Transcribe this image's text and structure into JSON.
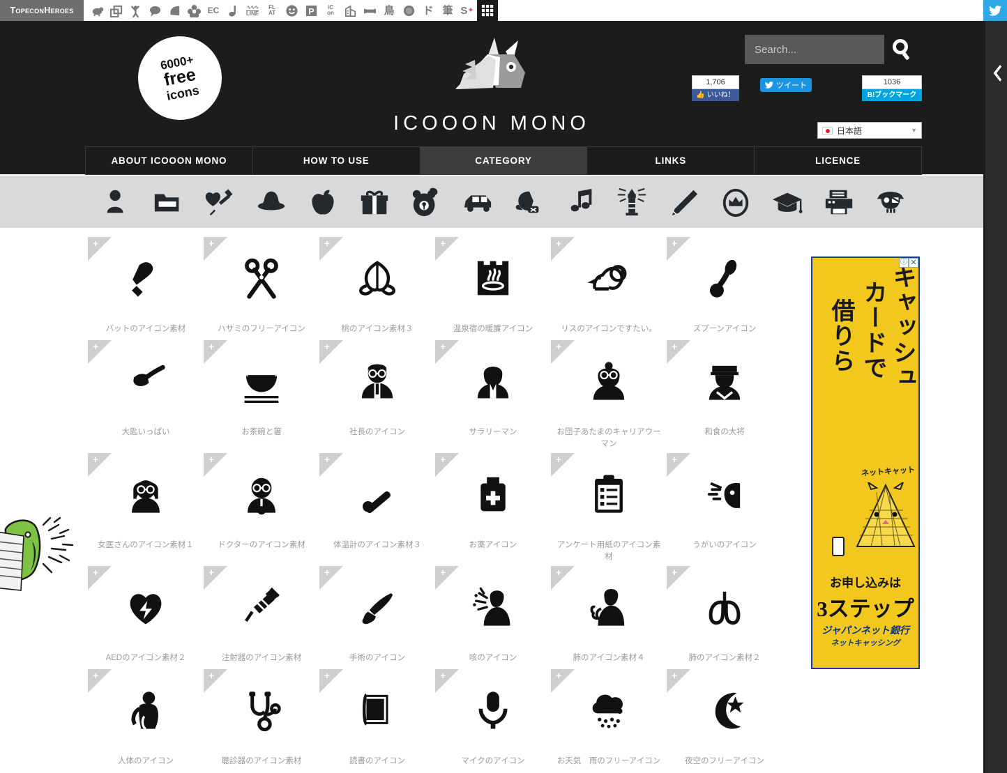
{
  "topbar": {
    "logo_text": "TopeconHeroes",
    "icons": [
      {
        "name": "sheep-icon",
        "glyph": "🐑"
      },
      {
        "name": "copy-icon",
        "glyph": "⧉"
      },
      {
        "name": "person-cheering-icon",
        "glyph": "Ɣ"
      },
      {
        "name": "speech-bubble-icon",
        "glyph": "⬤"
      },
      {
        "name": "leaf-icon",
        "glyph": "◆"
      },
      {
        "name": "flower-icon",
        "glyph": "❁"
      },
      {
        "name": "ec-text-icon",
        "glyph": "EC"
      },
      {
        "name": "music-note-icon",
        "glyph": "♪"
      },
      {
        "name": "line-icon",
        "glyph": "LINE"
      },
      {
        "name": "flat-icon",
        "glyph": "FLAT"
      },
      {
        "name": "smiley-icon",
        "glyph": "☺"
      },
      {
        "name": "parking-icon",
        "glyph": "P"
      },
      {
        "name": "icon-text-icon",
        "glyph": "iCon"
      },
      {
        "name": "building-icon",
        "glyph": "⌂"
      },
      {
        "name": "sofa-icon",
        "glyph": "▬"
      },
      {
        "name": "bird-kanji-icon",
        "glyph": "鳥"
      },
      {
        "name": "badge-round-icon",
        "glyph": "⬮"
      },
      {
        "name": "do-katakana-icon",
        "glyph": "ド"
      },
      {
        "name": "brush-kanji-icon",
        "glyph": "筆"
      },
      {
        "name": "s-plus-icon",
        "glyph": "S"
      },
      {
        "name": "grid-menu-icon",
        "glyph": "☷"
      }
    ],
    "twitter_label": "twitter-icon"
  },
  "rail": {
    "collapse_chevron": "‹"
  },
  "header": {
    "badge": {
      "line1": "6000+",
      "line2": "free",
      "line3": "icons"
    },
    "brand_name": "ICOOON MONO",
    "logo_name": "unicorn-logo",
    "search": {
      "placeholder": "Search...",
      "value": ""
    },
    "social": {
      "facebook_count": "1,706",
      "facebook_label": "いいね！",
      "twitter_label": "ツイート",
      "hatena_count": "1036",
      "hatena_label": "B!ブックマーク"
    },
    "language": {
      "selected": "日本語",
      "caret": "▼"
    }
  },
  "nav": {
    "items": [
      {
        "label": "ABOUT ICOOON MONO",
        "active": false,
        "key": "about"
      },
      {
        "label": "HOW TO USE",
        "active": false,
        "key": "how-to-use"
      },
      {
        "label": "CATEGORY",
        "active": true,
        "key": "category"
      },
      {
        "label": "LINKS",
        "active": false,
        "key": "links"
      },
      {
        "label": "LICENCE",
        "active": false,
        "key": "licence"
      }
    ]
  },
  "categories": [
    {
      "name": "person-icon"
    },
    {
      "name": "folder-icon"
    },
    {
      "name": "heart-syringe-icon"
    },
    {
      "name": "hat-icon"
    },
    {
      "name": "apple-icon"
    },
    {
      "name": "gift-icon"
    },
    {
      "name": "bear-icon"
    },
    {
      "name": "car-icon"
    },
    {
      "name": "boxing-glove-icon"
    },
    {
      "name": "music-note-icon"
    },
    {
      "name": "lighthouse-icon"
    },
    {
      "name": "pencil-icon"
    },
    {
      "name": "crown-badge-icon"
    },
    {
      "name": "graduation-cap-icon"
    },
    {
      "name": "printer-icon"
    },
    {
      "name": "pirate-skull-icon"
    }
  ],
  "grid": {
    "add_symbol": "+",
    "items": [
      {
        "label": "バットのアイコン素材",
        "icon": "baseball-bat-icon"
      },
      {
        "label": "ハサミのフリーアイコン",
        "icon": "scissors-icon"
      },
      {
        "label": "桃のアイコン素材３",
        "icon": "peach-icon"
      },
      {
        "label": "温泉宿の暖簾アイコン",
        "icon": "onsen-noren-icon"
      },
      {
        "label": "リスのアイコンですたい。",
        "icon": "squirrel-icon"
      },
      {
        "label": "スプーンアイコン",
        "icon": "spoon-icon"
      },
      {
        "label": "大匙いっぱい",
        "icon": "ladle-icon"
      },
      {
        "label": "お茶碗と箸",
        "icon": "rice-bowl-chopsticks-icon"
      },
      {
        "label": "社長のアイコン",
        "icon": "president-icon"
      },
      {
        "label": "サラリーマン",
        "icon": "salaryman-icon"
      },
      {
        "label": "お団子あたまのキャリアウーマン",
        "icon": "career-woman-icon"
      },
      {
        "label": "和食の大将",
        "icon": "sushi-chef-icon"
      },
      {
        "label": "女医さんのアイコン素材１",
        "icon": "female-doctor-icon"
      },
      {
        "label": "ドクターのアイコン素材",
        "icon": "doctor-icon"
      },
      {
        "label": "体温計のアイコン素材３",
        "icon": "thermometer-icon"
      },
      {
        "label": "お薬アイコン",
        "icon": "medicine-bottle-icon"
      },
      {
        "label": "アンケート用紙のアイコン素材",
        "icon": "questionnaire-clipboard-icon"
      },
      {
        "label": "うがいのアイコン",
        "icon": "gargle-icon"
      },
      {
        "label": "AEDのアイコン素材２",
        "icon": "aed-heart-icon"
      },
      {
        "label": "注射器のアイコン素材",
        "icon": "syringe-icon"
      },
      {
        "label": "手術のアイコン",
        "icon": "surgery-icon"
      },
      {
        "label": "咳のアイコン",
        "icon": "cough-icon"
      },
      {
        "label": "肺のアイコン素材４",
        "icon": "lungs-person-icon"
      },
      {
        "label": "肺のアイコン素材２",
        "icon": "lungs-icon"
      },
      {
        "label": "人体のアイコン",
        "icon": "human-body-icon"
      },
      {
        "label": "聴診器のアイコン素材",
        "icon": "stethoscope-icon"
      },
      {
        "label": "読書のアイコン",
        "icon": "book-icon"
      },
      {
        "label": "マイクのアイコン",
        "icon": "microphone-icon"
      },
      {
        "label": "お天気　雨のフリーアイコン",
        "icon": "rain-cloud-icon"
      },
      {
        "label": "夜空のフリーアイコン",
        "icon": "moon-star-icon"
      }
    ]
  },
  "ad": {
    "info_symbol": "ⓘ",
    "close_symbol": "✕",
    "headline_col1": "キャッシュ",
    "headline_col2": "カードで",
    "headline_col3": "借りら",
    "net_cat": "ネットキャット",
    "apply_line": "お申し込みは",
    "steps_line": "3ステップ",
    "bank": "ジャパンネット銀行",
    "bank_sub": "ネットキャッシング"
  },
  "colors": {
    "header_bg": "#1c1c1c",
    "catstrip_bg": "#d9d9d9",
    "accent_blue": "#1b95e0",
    "hatena_blue": "#00a4de",
    "ad_yellow": "#f2c81f"
  }
}
